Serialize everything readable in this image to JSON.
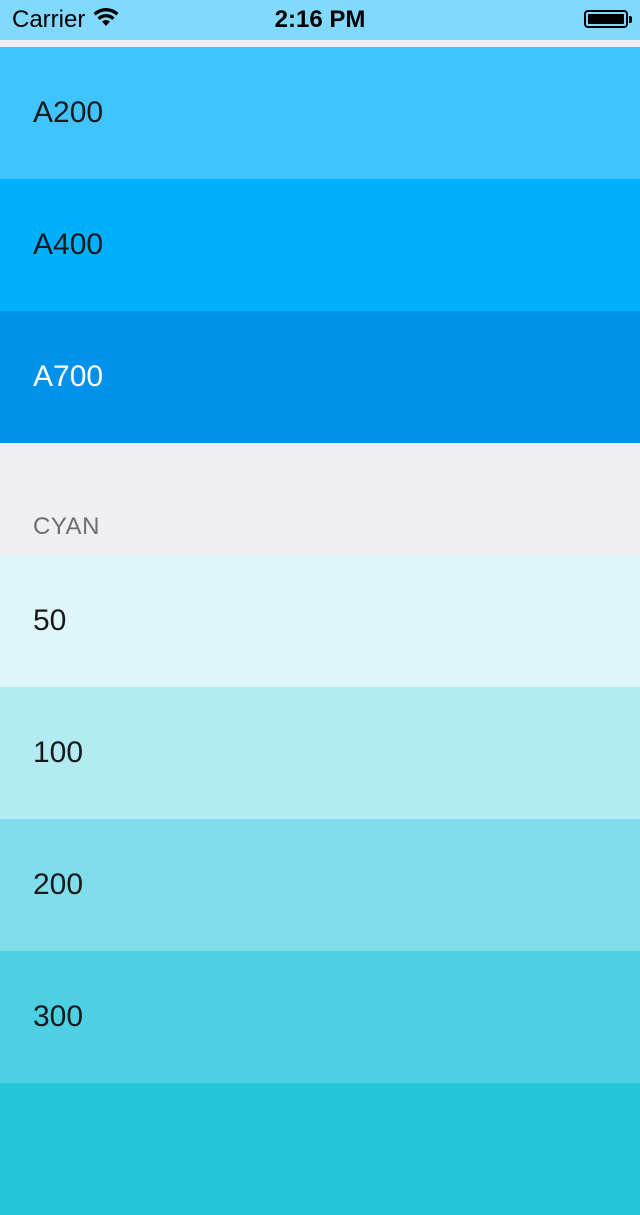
{
  "status_bar": {
    "carrier": "Carrier",
    "time": "2:16 PM"
  },
  "rows_top": [
    {
      "label": "A200",
      "color": "#40c4ff",
      "text_color": "#161a1d"
    },
    {
      "label": "A400",
      "color": "#00b0ff",
      "text_color": "#161a1d"
    },
    {
      "label": "A700",
      "color": "#0091ea",
      "text_color": "#ffffff"
    }
  ],
  "section": {
    "title": "CYAN"
  },
  "rows_cyan": [
    {
      "label": "50",
      "color": "#e0f7fa",
      "text_color": "#161a1d"
    },
    {
      "label": "100",
      "color": "#b2ebf2",
      "text_color": "#161a1d"
    },
    {
      "label": "200",
      "color": "#80deea",
      "text_color": "#161a1d"
    },
    {
      "label": "300",
      "color": "#4dd0e1",
      "text_color": "#161a1d"
    },
    {
      "label": "",
      "color": "#26c6da",
      "text_color": "#161a1d"
    }
  ]
}
